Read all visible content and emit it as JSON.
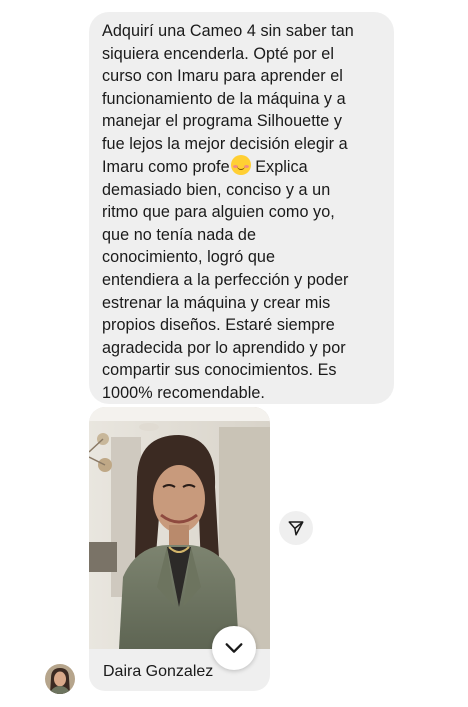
{
  "message": {
    "lines": [
      "Adquirí una Cameo 4 sin saber tan",
      "siquiera encenderla. Opté por el",
      "curso con Imaru para aprender el",
      "funcionamiento de la máquina y a",
      "manejar el programa Silhouette y",
      "fue lejos la mejor decisión elegir a",
      "Imaru como profe",
      "demasiado bien, conciso y a un",
      "ritmo que para alguien como yo,",
      "que no tenía nada de",
      "conocimiento, logró que",
      "entendiera a la perfección y poder",
      "estrenar la máquina y crear mis",
      "propios diseños. Estaré siempre",
      "agradecida por lo aprendido y por",
      "compartir sus conocimientos. Es",
      "1000% recomendable."
    ],
    "inline_after_emoji": " Explica",
    "emoji": "smiling-face-with-hearts"
  },
  "photo_post": {
    "caption": "Daira Gonzalez"
  },
  "icons": {
    "share": "paper-plane-icon",
    "expand": "chevron-down-icon"
  },
  "colors": {
    "bubble": "#efefef",
    "text": "#1a1a1a"
  }
}
